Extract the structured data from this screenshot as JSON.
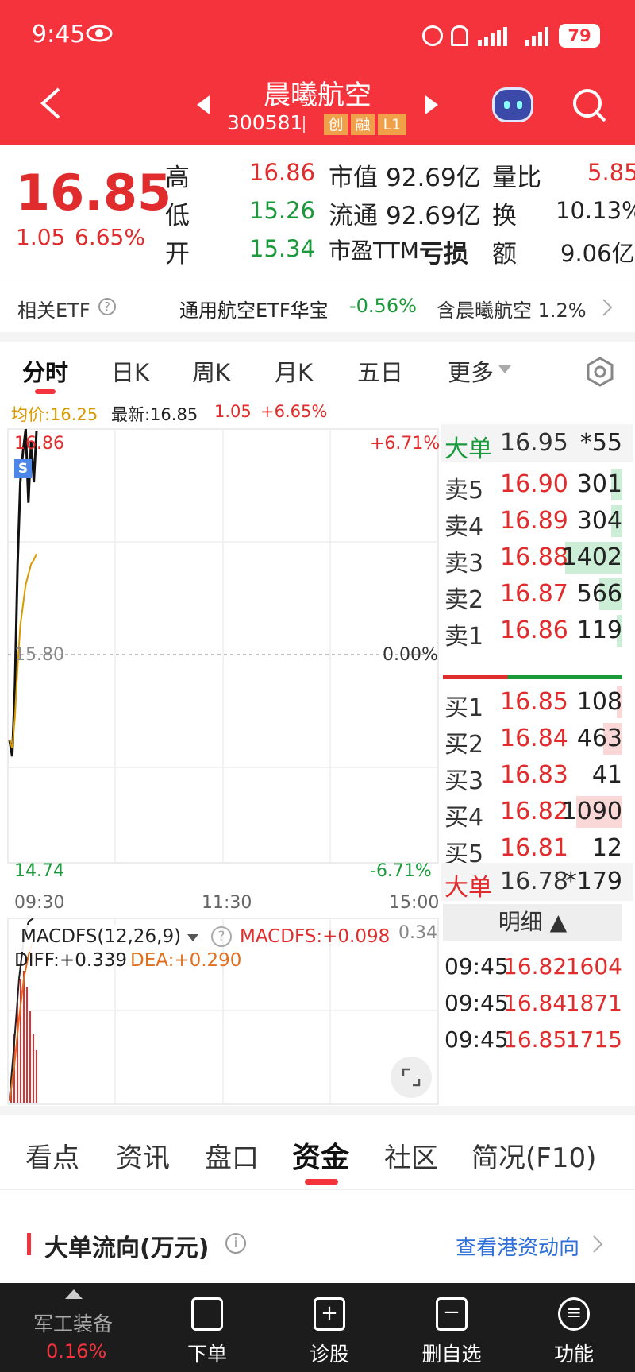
{
  "status_bar": {
    "time": "9:45",
    "battery": "79"
  },
  "header": {
    "title": "晨曦航空",
    "code": "300581",
    "badges": [
      "创",
      "融",
      "L1"
    ]
  },
  "quote": {
    "price": "16.85",
    "change": "1.05",
    "change_pct": "6.65%",
    "high_label": "高",
    "high": "16.86",
    "low_label": "低",
    "low": "15.26",
    "open_label": "开",
    "open": "15.34",
    "mktcap_label": "市值",
    "mktcap": "92.69亿",
    "float_label": "流通",
    "float": "92.69亿",
    "pe_label": "市盈TTM",
    "pe": "亏损",
    "vol_ratio_label": "量比",
    "vol_ratio": "5.85",
    "turnover_label": "换",
    "turnover": "10.13%",
    "amount_label": "额",
    "amount": "9.06亿"
  },
  "etf": {
    "label": "相关ETF",
    "name": "通用航空ETF华宝",
    "change": "-0.56%",
    "holding": "含晨曦航空 1.2%"
  },
  "chart_tabs": [
    "分时",
    "日K",
    "周K",
    "月K",
    "五日",
    "更多"
  ],
  "chart_info": {
    "avg": "均价:16.25",
    "latest": "最新:16.85",
    "chg": "1.05",
    "chg_pct": "+6.65%"
  },
  "chart_labels": {
    "top_price": "16.86",
    "top_pct": "+6.71%",
    "mid_price": "15.80",
    "mid_pct": "0.00%",
    "bot_price": "14.74",
    "bot_pct": "-6.71%",
    "t_start": "09:30",
    "t_mid": "11:30",
    "t_end": "15:00",
    "marker": "S"
  },
  "chart_data": {
    "type": "line",
    "x_axis": [
      "09:30",
      "11:30",
      "15:00"
    ],
    "ylim": [
      14.74,
      16.86
    ],
    "series": [
      {
        "name": "最新",
        "values": [
          15.34,
          15.26,
          15.6,
          16.2,
          16.6,
          16.75,
          16.86,
          16.5,
          16.8,
          16.6,
          16.85
        ]
      },
      {
        "name": "均价",
        "values": [
          15.34,
          15.3,
          15.45,
          15.7,
          15.9,
          16.0,
          16.1,
          16.15,
          16.2,
          16.22,
          16.25
        ]
      }
    ]
  },
  "macd": {
    "name": "MACDFS(12,26,9)",
    "macdfs": "MACDFS:+0.098",
    "diff": "DIFF:+0.339",
    "dea": "DEA:+0.290",
    "scale": "0.34"
  },
  "orderbook": {
    "big_top": {
      "label": "大单",
      "price": "16.95",
      "vol": "*55"
    },
    "asks": [
      {
        "label": "卖5",
        "price": "16.90",
        "vol": "301",
        "bar": 0.06
      },
      {
        "label": "卖4",
        "price": "16.89",
        "vol": "304",
        "bar": 0.06
      },
      {
        "label": "卖3",
        "price": "16.88",
        "vol": "1402",
        "bar": 0.3
      },
      {
        "label": "卖2",
        "price": "16.87",
        "vol": "566",
        "bar": 0.12
      },
      {
        "label": "卖1",
        "price": "16.86",
        "vol": "119",
        "bar": 0.03
      }
    ],
    "bids": [
      {
        "label": "买1",
        "price": "16.85",
        "vol": "108",
        "bar": 0.03
      },
      {
        "label": "买2",
        "price": "16.84",
        "vol": "463",
        "bar": 0.1
      },
      {
        "label": "买3",
        "price": "16.83",
        "vol": "41",
        "bar": 0.0
      },
      {
        "label": "买4",
        "price": "16.82",
        "vol": "1090",
        "bar": 0.24
      },
      {
        "label": "买5",
        "price": "16.81",
        "vol": "12",
        "bar": 0.0
      }
    ],
    "big_bot": {
      "label": "大单",
      "price": "16.78",
      "vol": "*179"
    },
    "detail_label": "明细",
    "trades": [
      {
        "time": "09:45",
        "price": "16.82",
        "vol": "1604"
      },
      {
        "time": "09:45",
        "price": "16.84",
        "vol": "1871"
      },
      {
        "time": "09:45",
        "price": "16.85",
        "vol": "1715"
      }
    ]
  },
  "bottom_tabs": [
    "看点",
    "资讯",
    "盘口",
    "资金",
    "社区",
    "简况(F10)"
  ],
  "flow": {
    "title": "大单流向(万元)",
    "link": "查看港资动向"
  },
  "nav": {
    "sector": "军工装备",
    "sector_chg": "0.16%",
    "items": [
      "下单",
      "诊股",
      "删自选",
      "功能"
    ]
  },
  "colors": {
    "brand": "#f5333d",
    "up": "#e02c2c",
    "down": "#1a9a3a",
    "avg_line": "#d89a00"
  }
}
